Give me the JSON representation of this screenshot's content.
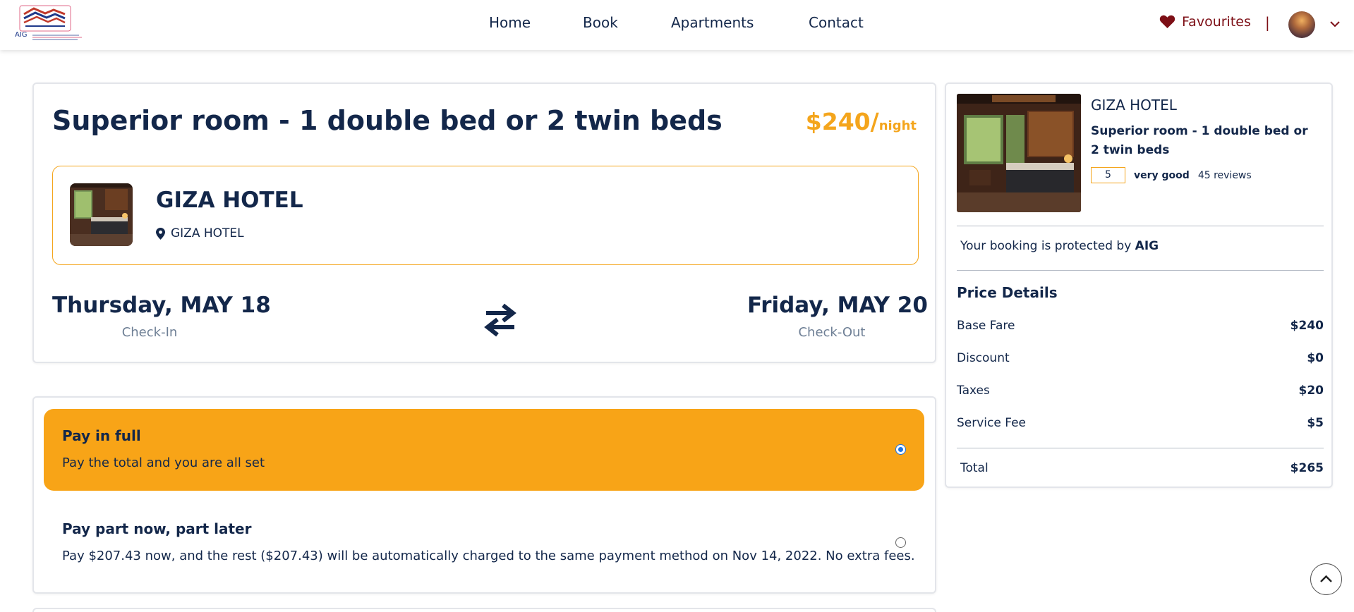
{
  "header": {
    "logo_text": "AIG",
    "nav": [
      "Home",
      "Book",
      "Apartments",
      "Contact"
    ],
    "favourites_label": "Favourites",
    "separator": "|"
  },
  "room": {
    "title": "Superior room - 1 double bed or 2 twin beds",
    "price_amount": "$240/",
    "price_unit": "night",
    "hotel_name": "GIZA HOTEL",
    "hotel_location": "GIZA HOTEL",
    "checkin_date": "Thursday, MAY 18",
    "checkin_label": "Check-In",
    "checkout_date": "Friday, MAY 20",
    "checkout_label": "Check-Out"
  },
  "payment": {
    "full_title": "Pay in full",
    "full_desc": "Pay the total and you are all set",
    "part_title": "Pay part now, part later",
    "part_desc": "Pay $207.43 now, and the rest ($207.43) will be automatically charged to the same payment method on Nov 14, 2022. No extra fees.",
    "selected": "full"
  },
  "summary": {
    "hotel_name": "GIZA HOTEL",
    "room_title": "Superior room - 1 double bed or 2 twin beds",
    "rating": "5",
    "rating_word": "very good",
    "reviews": "45 reviews",
    "protected_text": "Your booking is protected by ",
    "protected_brand": "AIG",
    "price_details_title": "Price Details",
    "rows": [
      {
        "label": "Base Fare",
        "value": "$240"
      },
      {
        "label": "Discount",
        "value": "$0"
      },
      {
        "label": "Taxes",
        "value": "$20"
      },
      {
        "label": "Service Fee",
        "value": "$5"
      }
    ],
    "total_label": "Total",
    "total_value": "$265"
  },
  "colors": {
    "navy": "#13274a",
    "accent": "#f8a417",
    "favourite": "#7d0f16",
    "radio_selected": "#1a73e8"
  },
  "icons": {
    "favourites": "heart-icon",
    "location": "map-pin-icon",
    "swap": "swap-arrows-icon",
    "dropdown": "chevron-down-icon",
    "scroll_top": "chevron-up-icon"
  }
}
